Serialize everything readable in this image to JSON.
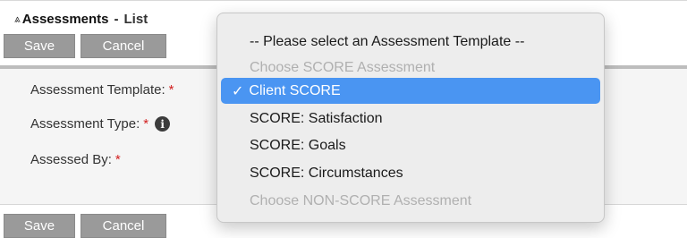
{
  "header": {
    "title": "Assessments",
    "separator": "-",
    "subtitle": "List"
  },
  "toolbar": {
    "save_label": "Save",
    "cancel_label": "Cancel"
  },
  "form": {
    "assessment_template_label": "Assessment Template:",
    "assessment_type_label": "Assessment Type:",
    "assessed_by_label": "Assessed By:",
    "required_marker": "*",
    "info_glyph": "i"
  },
  "dropdown": {
    "check_glyph": "✓",
    "options": [
      {
        "label": "-- Please select an Assessment Template --",
        "disabled": false,
        "selected": false
      },
      {
        "label": "Choose SCORE Assessment",
        "disabled": true,
        "selected": false
      },
      {
        "label": "Client SCORE",
        "disabled": false,
        "selected": true
      },
      {
        "label": "SCORE: Satisfaction",
        "disabled": false,
        "selected": false
      },
      {
        "label": "SCORE: Goals",
        "disabled": false,
        "selected": false
      },
      {
        "label": "SCORE: Circumstances",
        "disabled": false,
        "selected": false
      },
      {
        "label": "Choose NON-SCORE Assessment",
        "disabled": true,
        "selected": false
      }
    ]
  },
  "colors": {
    "selection": "#4a95f2",
    "required": "#d21f1f",
    "button": "#9a9a9a"
  }
}
